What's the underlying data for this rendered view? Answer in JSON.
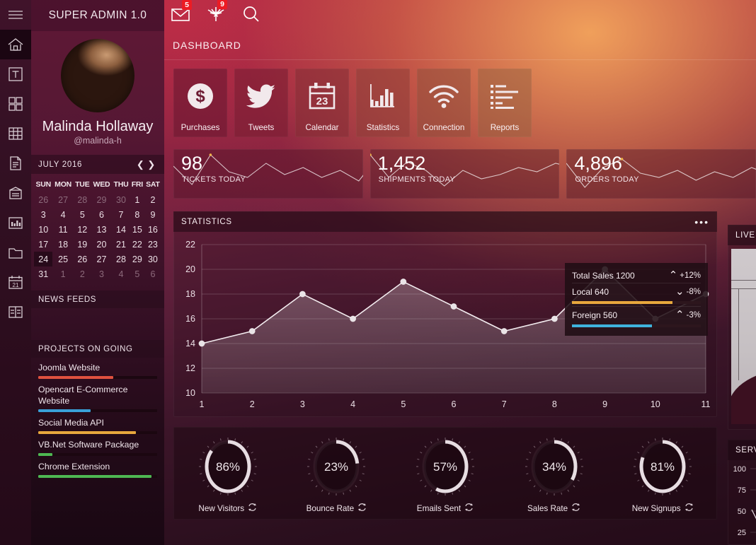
{
  "app": {
    "title": "SUPER ADMIN 1.0"
  },
  "rail": {
    "items": [
      {
        "name": "hamburger-menu",
        "icon": "hamburger-icon",
        "active": false
      },
      {
        "name": "home",
        "icon": "home-icon",
        "active": true
      },
      {
        "name": "typography",
        "icon": "typography-icon",
        "active": false
      },
      {
        "name": "widgets",
        "icon": "grid-icon",
        "active": false
      },
      {
        "name": "tables",
        "icon": "table-icon",
        "active": false
      },
      {
        "name": "forms",
        "icon": "document-icon",
        "active": false
      },
      {
        "name": "pages",
        "icon": "pages-icon",
        "active": false
      },
      {
        "name": "charts",
        "icon": "bar-chart-icon",
        "active": false
      },
      {
        "name": "files",
        "icon": "folder-icon",
        "active": false
      },
      {
        "name": "calendar",
        "icon": "calendar-icon",
        "active": false
      },
      {
        "name": "layouts",
        "icon": "layout-icon",
        "active": false
      }
    ]
  },
  "topbar": {
    "mail_icon": "envelope-icon",
    "mail_badge": "5",
    "collapse_icon": "collapse-arrows-icon",
    "collapse_badge": "9",
    "search_icon": "search-icon"
  },
  "header": {
    "title": "DASHBOARD"
  },
  "profile": {
    "avatar": "user-avatar",
    "name": "Malinda Hollaway",
    "handle": "@malinda-h"
  },
  "calendar": {
    "month_label": "JULY 2016",
    "prev_icon": "chevron-left-icon",
    "next_icon": "chevron-right-icon",
    "weekdays": [
      "SUN",
      "MON",
      "TUE",
      "WED",
      "THU",
      "FRI",
      "SAT"
    ],
    "selected_day": "24",
    "weeks": [
      [
        {
          "d": "26",
          "o": true
        },
        {
          "d": "27",
          "o": true
        },
        {
          "d": "28",
          "o": true
        },
        {
          "d": "29",
          "o": true
        },
        {
          "d": "30",
          "o": true
        },
        {
          "d": "1",
          "o": false
        },
        {
          "d": "2",
          "o": false
        }
      ],
      [
        {
          "d": "3",
          "o": false
        },
        {
          "d": "4",
          "o": false
        },
        {
          "d": "5",
          "o": false
        },
        {
          "d": "6",
          "o": false
        },
        {
          "d": "7",
          "o": false
        },
        {
          "d": "8",
          "o": false
        },
        {
          "d": "9",
          "o": false
        }
      ],
      [
        {
          "d": "10",
          "o": false
        },
        {
          "d": "11",
          "o": false
        },
        {
          "d": "12",
          "o": false
        },
        {
          "d": "13",
          "o": false
        },
        {
          "d": "14",
          "o": false
        },
        {
          "d": "15",
          "o": false
        },
        {
          "d": "16",
          "o": false
        }
      ],
      [
        {
          "d": "17",
          "o": false
        },
        {
          "d": "18",
          "o": false
        },
        {
          "d": "19",
          "o": false
        },
        {
          "d": "20",
          "o": false
        },
        {
          "d": "21",
          "o": false
        },
        {
          "d": "22",
          "o": false
        },
        {
          "d": "23",
          "o": false
        }
      ],
      [
        {
          "d": "24",
          "o": false,
          "sel": true
        },
        {
          "d": "25",
          "o": false
        },
        {
          "d": "26",
          "o": false
        },
        {
          "d": "27",
          "o": false
        },
        {
          "d": "28",
          "o": false
        },
        {
          "d": "29",
          "o": false
        },
        {
          "d": "30",
          "o": false
        }
      ],
      [
        {
          "d": "31",
          "o": false
        },
        {
          "d": "1",
          "o": true
        },
        {
          "d": "2",
          "o": true
        },
        {
          "d": "3",
          "o": true
        },
        {
          "d": "4",
          "o": true
        },
        {
          "d": "5",
          "o": true
        },
        {
          "d": "6",
          "o": true
        }
      ]
    ]
  },
  "news_feeds": {
    "title": "NEWS FEEDS"
  },
  "projects": {
    "title": "PROJECTS ON GOING",
    "items": [
      {
        "label": "Joomla Website",
        "percent": 63,
        "color": "#e0513f"
      },
      {
        "label": "Opencart E-Commerce Website",
        "percent": 44,
        "color": "#39a0d8"
      },
      {
        "label": "Social Media API",
        "percent": 82,
        "color": "#e8a83d"
      },
      {
        "label": "VB.Net Software Package",
        "percent": 12,
        "color": "#4eb852"
      },
      {
        "label": "Chrome Extension",
        "percent": 95,
        "color": "#4eb852"
      }
    ]
  },
  "tiles": [
    {
      "label": "Purchases",
      "icon": "dollar-circle-icon"
    },
    {
      "label": "Tweets",
      "icon": "twitter-bird-icon"
    },
    {
      "label": "Calendar",
      "icon": "calendar-23-icon"
    },
    {
      "label": "Statistics",
      "icon": "bar-chart-icon"
    },
    {
      "label": "Connection",
      "icon": "wifi-icon"
    },
    {
      "label": "Reports",
      "icon": "list-report-icon"
    }
  ],
  "stat_cards": [
    {
      "value": "98",
      "label": "TICKETS TODAY",
      "spark": [
        46,
        20,
        62,
        38,
        30,
        50,
        34,
        44,
        30,
        40,
        25,
        58
      ]
    },
    {
      "value": "1,452",
      "label": "SHIPMENTS TODAY",
      "spark": [
        62,
        30,
        52,
        40,
        18,
        40,
        28,
        34,
        44,
        38,
        50,
        44
      ]
    },
    {
      "value": "4,896",
      "label": "ORDERS TODAY",
      "spark": [
        50,
        16,
        44,
        56,
        36,
        30,
        40,
        26,
        38,
        30,
        44,
        34
      ]
    }
  ],
  "statistics_panel": {
    "title": "STATISTICS",
    "menu_icon": "more-dots-icon"
  },
  "chart_data": {
    "type": "line",
    "title": "STATISTICS",
    "x": [
      1,
      2,
      3,
      4,
      5,
      6,
      7,
      8,
      9,
      10,
      11
    ],
    "values": [
      14,
      15,
      18,
      16,
      19,
      17,
      15,
      16,
      20,
      16,
      18
    ],
    "xlabel": "",
    "ylabel": "",
    "ylim": [
      10,
      22
    ],
    "yticks": [
      10,
      12,
      14,
      16,
      18,
      20,
      22
    ],
    "xticks": [
      "1",
      "2",
      "3",
      "4",
      "5",
      "6",
      "7",
      "8",
      "9",
      "10",
      "11"
    ],
    "grid": true,
    "legend": "none",
    "area_fill": true,
    "marker": "circle"
  },
  "tooltip": {
    "rows": [
      {
        "label": "Total Sales 1200",
        "delta": "+12%",
        "dir": "up",
        "bar_percent": 0,
        "bar_color": ""
      },
      {
        "label": "Local 640",
        "delta": "-8%",
        "dir": "down",
        "bar_percent": 78,
        "bar_color": "#e8a83d"
      },
      {
        "label": "Foreign 560",
        "delta": "-3%",
        "dir": "up",
        "bar_percent": 62,
        "bar_color": "#3fb3dd"
      }
    ]
  },
  "gauges": [
    {
      "label": "New Visitors",
      "percent": 86,
      "value_text": "86%",
      "refresh_icon": "refresh-icon"
    },
    {
      "label": "Bounce Rate",
      "percent": 23,
      "value_text": "23%",
      "refresh_icon": "refresh-icon"
    },
    {
      "label": "Emails Sent",
      "percent": 57,
      "value_text": "57%",
      "refresh_icon": "refresh-icon"
    },
    {
      "label": "Sales Rate",
      "percent": 34,
      "value_text": "34%",
      "refresh_icon": "refresh-icon"
    },
    {
      "label": "New Signups",
      "percent": 81,
      "value_text": "81%",
      "refresh_icon": "refresh-icon"
    }
  ],
  "live_panel": {
    "title": "LIVE VIEW"
  },
  "server_panel": {
    "title": "SERVER LOAD",
    "yticks": [
      "100",
      "75",
      "50",
      "25"
    ]
  },
  "colors": {
    "accent_red": "#ec1c24",
    "brand_orange": "#e8a83d",
    "brand_blue": "#3fb3dd",
    "brand_green": "#4eb852"
  }
}
